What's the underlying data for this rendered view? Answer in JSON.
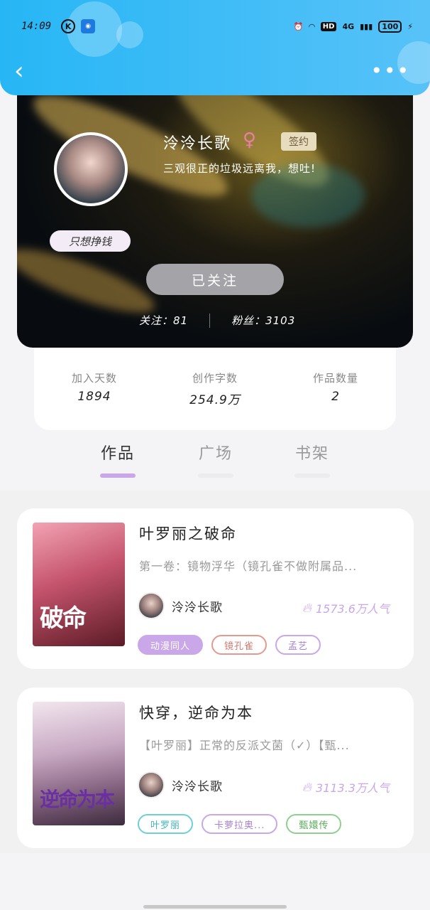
{
  "status_bar": {
    "time": "14:09",
    "network": "4G",
    "battery": "100",
    "hd": "HD"
  },
  "profile": {
    "username": "泠泠长歌",
    "gender_symbol": "♀",
    "signed_badge": "签约",
    "bio": "三观很正的垃圾远离我，想吐!",
    "avatar_tag": "只想挣钱",
    "follow_button": "已关注",
    "following_label": "关注：81",
    "fans_label": "粉丝：3103"
  },
  "stats": [
    {
      "label": "加入天数",
      "value": "1894"
    },
    {
      "label": "创作字数",
      "value": "254.9万"
    },
    {
      "label": "作品数量",
      "value": "2"
    }
  ],
  "tabs": [
    {
      "label": "作品",
      "active": true
    },
    {
      "label": "广场",
      "active": false
    },
    {
      "label": "书架",
      "active": false
    }
  ],
  "books": [
    {
      "title": "叶罗丽之破命",
      "description": "第一卷：镜物浮华（镜孔雀不做附属品...",
      "author": "泠泠长歌",
      "popularity": "1573.6万人气",
      "cover_title": "破命",
      "tags": [
        {
          "label": "动漫同人",
          "color": "#c9a7e8",
          "filled": true
        },
        {
          "label": "镜孔雀",
          "color": "#e29a8f",
          "filled": false
        },
        {
          "label": "孟艺",
          "color": "#c9a7e8",
          "filled": false
        }
      ]
    },
    {
      "title": "快穿，逆命为本",
      "description": "【叶罗丽】正常的反派文菌（✓）【甄...",
      "author": "泠泠长歌",
      "popularity": "3113.3万人气",
      "cover_title": "逆命为本",
      "tags": [
        {
          "label": "叶罗丽",
          "color": "#6fcfd9",
          "filled": false
        },
        {
          "label": "卡萝拉奥...",
          "color": "#c9a7e8",
          "filled": false
        },
        {
          "label": "甄嬛传",
          "color": "#8fd08f",
          "filled": false
        }
      ]
    }
  ],
  "colors": {
    "header": "#27b6f5",
    "accent": "#c9a7e8"
  },
  "icons": {
    "back": "chevron-left-icon",
    "more": "more-dots-icon",
    "fire": "fire-icon"
  }
}
